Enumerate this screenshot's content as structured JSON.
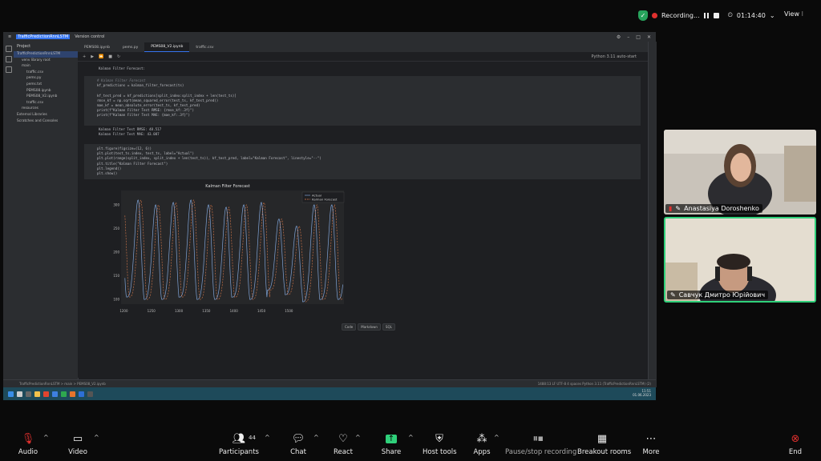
{
  "recording": {
    "label": "Recording...",
    "time": "01:14:40",
    "view_label": "View"
  },
  "ide": {
    "project_name": "TrafficPredictionRnnLSTM",
    "version_control": "Version control",
    "tabs": [
      "PEMS08.ipynb",
      "pems.py",
      "PEMS08_V2.ipynb",
      "traffic.csv"
    ],
    "project_label": "Project",
    "tree": [
      "TrafficPredictionRnnLSTM",
      "venv library root",
      "main",
      "traffic.csv",
      "pems.py",
      "pems.txt",
      "PEMS08.ipynb",
      "PEMS08_V2.ipynb",
      "traffic.csv",
      "resources",
      "External Libraries",
      "Scratches and Consoles"
    ],
    "kernel": "Python 3.11 (TrafficPredictionRnnLSTM)",
    "toolbar_right": "Python 3.11 auto-start",
    "output_title": "Kalman Filter Forecast:",
    "code1": [
      "# Kalman Filter Forecast",
      "kf_predictions = kalman_filter_forecast(ts)",
      "",
      "kf_test_pred = kf_predictions[split_index:split_index + len(test_ts)]",
      "rmse_kf = np.sqrt(mean_squared_error(test_ts, kf_test_pred))",
      "mae_kf = mean_absolute_error(test_ts, kf_test_pred)",
      "print(f\"Kalman Filter Test RMSE: {rmse_kf:.3f}\")",
      "print(f\"Kalman Filter Test MAE: {mae_kf:.3f}\")"
    ],
    "out1": [
      "Kalman Filter Test RMSE: 48.517",
      "Kalman Filter Test MAE: 43.087"
    ],
    "code2": [
      "plt.figure(figsize=(12, 6))",
      "plt.plot(test_ts.index, test_ts, label=\"Actual\")",
      "plt.plot(range(split_index, split_index + len(test_ts)), kf_test_pred, label=\"Kalman Forecast\", linestyle=\"--\")",
      "plt.title(\"Kalman Filter Forecast\")",
      "plt.legend()",
      "plt.show()"
    ],
    "cell_buttons": [
      "Code",
      "Markdown",
      "SQL"
    ],
    "status_path": "TrafficPredictionRnnLSTM > main > PEMS08_V2.ipynb",
    "status_right": "1488:13   LF   UTF-8   4 spaces   Python 3.11 (TrafficPredictionRnnLSTM) (2)",
    "clock_time": "11:51",
    "clock_date": "01.06.2023"
  },
  "chart_data": {
    "type": "line",
    "title": "Kalman Filter Forecast",
    "xlabel": "",
    "ylabel": "",
    "xlim": [
      1195,
      1600
    ],
    "ylim": [
      90,
      330
    ],
    "xticks": [
      1200,
      1250,
      1300,
      1350,
      1400,
      1450,
      1500
    ],
    "yticks": [
      100,
      150,
      200,
      250,
      300
    ],
    "legend": "top-right",
    "series": [
      {
        "name": "Actual",
        "color": "#7fa3d6",
        "style": "solid"
      },
      {
        "name": "Kalman Forecast",
        "color": "#d9794a",
        "style": "dashed"
      }
    ],
    "period": 32,
    "peaks": [
      310,
      300,
      305,
      310,
      300,
      295,
      300,
      305,
      270,
      255,
      300,
      300,
      295
    ],
    "troughs": [
      105,
      100,
      100,
      105,
      100,
      100,
      105,
      100,
      120,
      110,
      95,
      100,
      100
    ]
  },
  "participants": [
    {
      "name": "Anastasiya Doroshenko"
    },
    {
      "name": "Савчук Дмитро Юрійович"
    }
  ],
  "controls": [
    {
      "label": "Audio"
    },
    {
      "label": "Video"
    },
    {
      "label": "Participants",
      "badge": "44"
    },
    {
      "label": "Chat"
    },
    {
      "label": "React"
    },
    {
      "label": "Share"
    },
    {
      "label": "Host tools"
    },
    {
      "label": "Apps"
    },
    {
      "label": "Pause/stop recording"
    },
    {
      "label": "Breakout rooms"
    },
    {
      "label": "More"
    },
    {
      "label": "End"
    }
  ]
}
